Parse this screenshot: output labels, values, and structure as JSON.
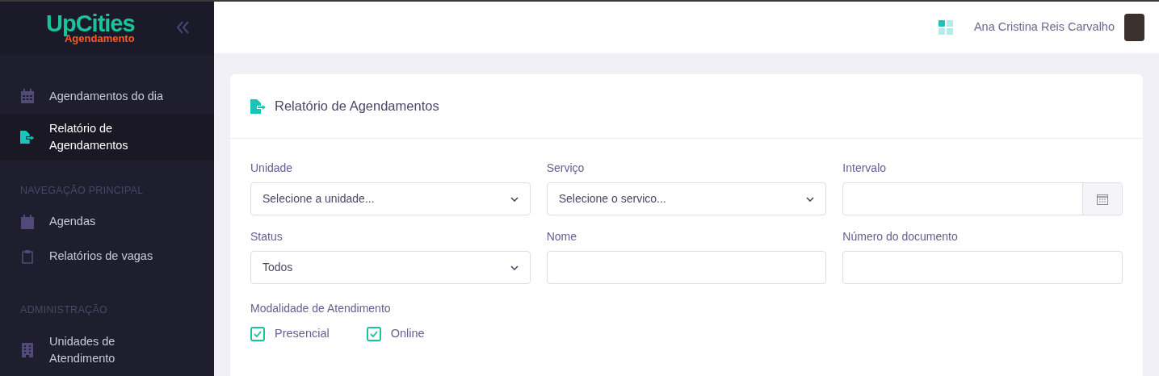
{
  "sidebar": {
    "logo": {
      "title": "UpCities",
      "subtitle": "Agendamento"
    },
    "top_items": [
      {
        "label": "Agendamentos do dia",
        "selected": false
      },
      {
        "label": "Relatório de Agendamentos",
        "selected": true
      }
    ],
    "sections": [
      {
        "title": "NAVEGAÇÃO PRINCIPAL",
        "items": [
          {
            "label": "Agendas",
            "selected": false
          },
          {
            "label": "Relatórios de vagas",
            "selected": false
          }
        ]
      },
      {
        "title": "ADMINISTRAÇÃO",
        "items": [
          {
            "label": "Unidades de Atendimento",
            "selected": false
          }
        ]
      }
    ]
  },
  "header": {
    "user_name": "Ana Cristina Reis Carvalho"
  },
  "card": {
    "title": "Relatório de Agendamentos",
    "fields": [
      {
        "kind": "select",
        "label": "Unidade",
        "value": "Selecione a unidade..."
      },
      {
        "kind": "select",
        "label": "Serviço",
        "value": "Selecione o servico..."
      },
      {
        "kind": "date",
        "label": "Intervalo"
      },
      {
        "kind": "select",
        "label": "Status",
        "value": "Todos"
      },
      {
        "kind": "text",
        "label": "Nome"
      },
      {
        "kind": "text",
        "label": "Número do documento"
      }
    ],
    "modality": {
      "label": "Modalidade de Atendimento",
      "options": [
        {
          "label": "Presencial",
          "checked": true
        },
        {
          "label": "Online",
          "checked": true
        }
      ]
    }
  }
}
